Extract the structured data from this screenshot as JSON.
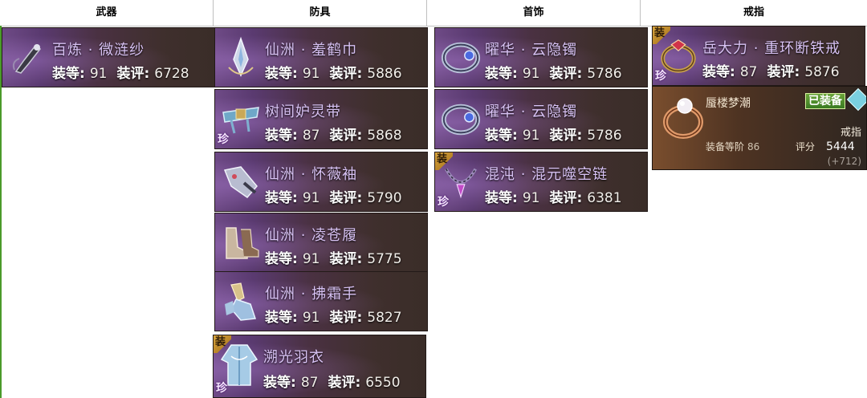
{
  "header": {
    "columns": [
      "武器",
      "防具",
      "首饰",
      "戒指"
    ]
  },
  "labels": {
    "level": "装等:",
    "score": "装评:"
  },
  "weapon": [
    {
      "name": "百炼 · 微涟纱",
      "level": "91",
      "score": "6728",
      "icon": "fan-weapon-icon"
    }
  ],
  "armor": [
    {
      "name": "仙洲 · 羞鹤巾",
      "level": "91",
      "score": "5886",
      "icon": "headpiece-icon"
    },
    {
      "name": "树间妒灵带",
      "level": "87",
      "score": "5868",
      "icon": "belt-icon",
      "tag_zhen": "珍"
    },
    {
      "name": "仙洲 · 怀薇袖",
      "level": "91",
      "score": "5790",
      "icon": "sleeve-icon"
    },
    {
      "name": "仙洲 · 凌苍履",
      "level": "91",
      "score": "5775",
      "icon": "boots-icon"
    },
    {
      "name": "仙洲 · 拂霜手",
      "level": "91",
      "score": "5827",
      "icon": "gloves-icon"
    },
    {
      "name": "溯光羽衣",
      "level": "87",
      "score": "6550",
      "icon": "robe-icon",
      "tag_zhuang": "装",
      "tag_zhen": "珍"
    }
  ],
  "jewelry": [
    {
      "name": "曜华 · 云隐镯",
      "level": "91",
      "score": "5786",
      "icon": "bracelet-icon"
    },
    {
      "name": "曜华 · 云隐镯",
      "level": "91",
      "score": "5786",
      "icon": "bracelet-icon"
    },
    {
      "name": "混沌 · 混元噬空链",
      "level": "91",
      "score": "6381",
      "icon": "necklace-icon",
      "tag_zhuang": "装",
      "tag_zhen": "珍"
    }
  ],
  "ring": [
    {
      "name": "岳大力 · 重环断铁戒",
      "level": "87",
      "score": "5876",
      "icon": "ring-icon",
      "tag_zhuang": "装",
      "tag_zhen": "珍"
    }
  ],
  "tooltip": {
    "name": "蜃楼梦潮",
    "equipped": "已装备",
    "slot": "戒指",
    "level_label": "装备等阶",
    "level_value": "86",
    "score_label": "评分",
    "score_value": "5444",
    "bonus": "(+712)",
    "icon": "pearl-ring-icon"
  },
  "colors": {
    "accent_green": "#4a9a2a",
    "name_purple": "#d8c2f4",
    "tag_gold": "#d8a43c"
  }
}
